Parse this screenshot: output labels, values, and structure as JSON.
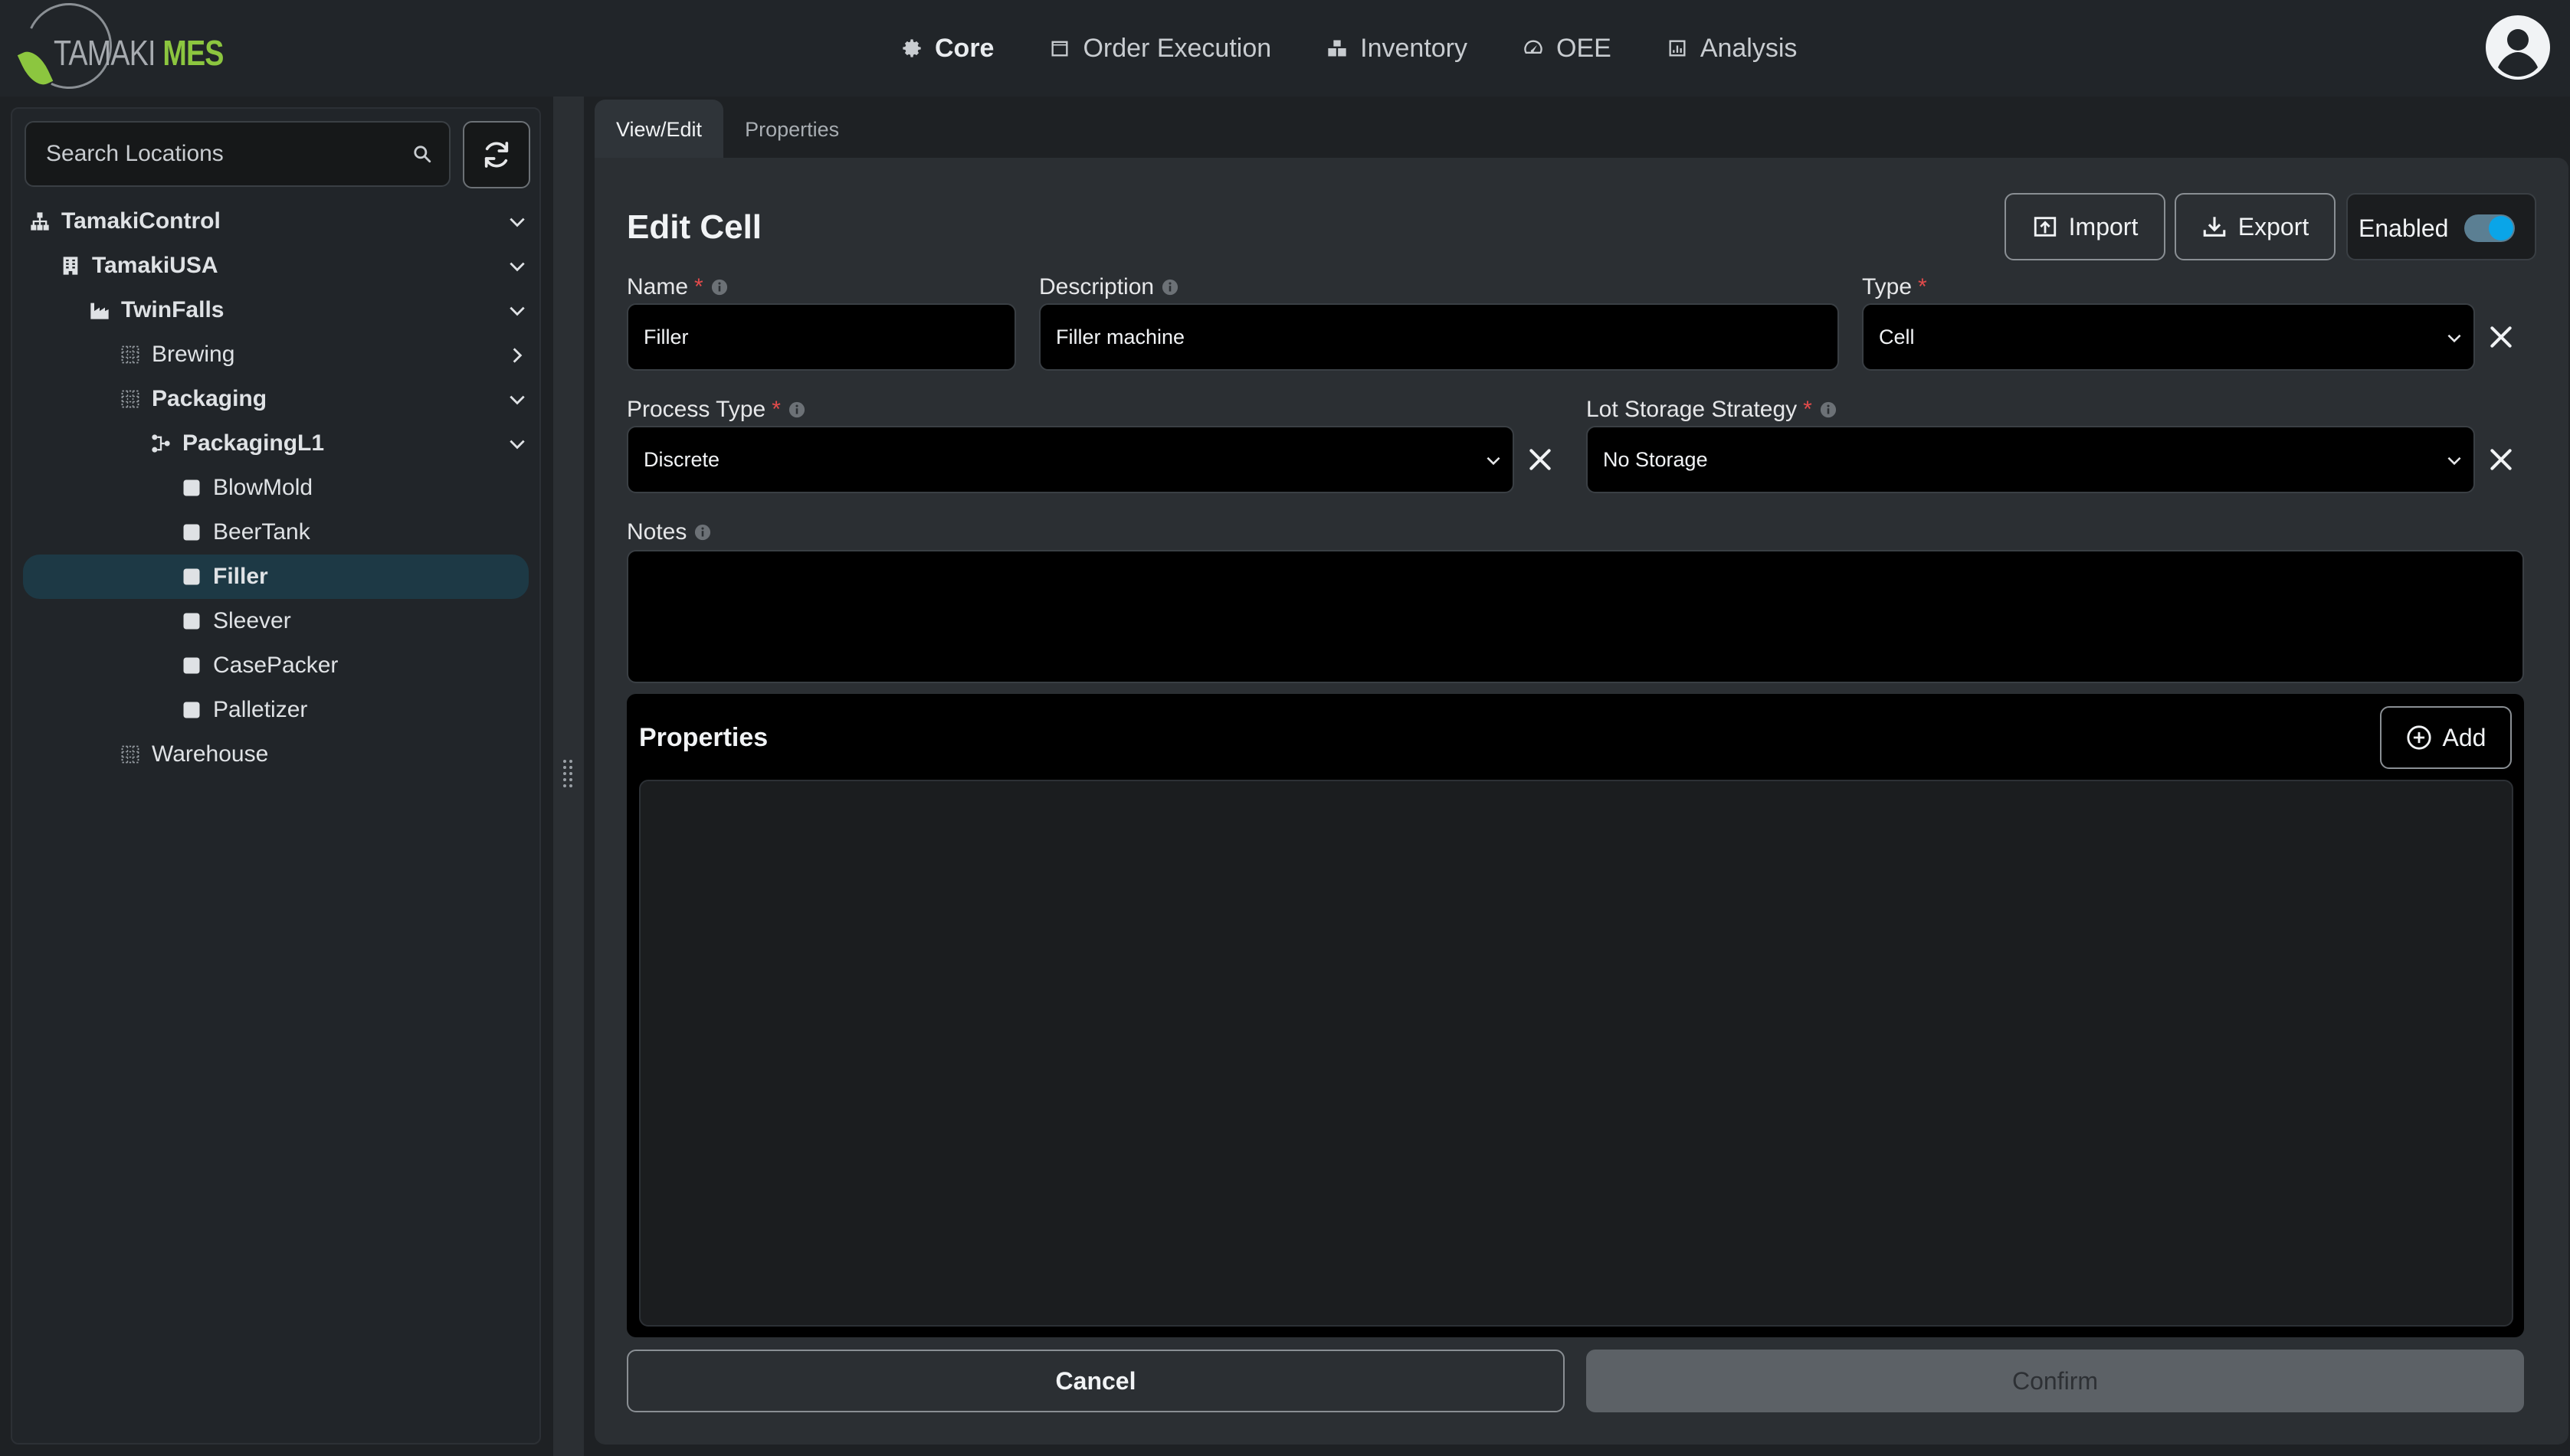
{
  "app": {
    "logo_part1": "TAMAKI",
    "logo_part2": "MES"
  },
  "nav": {
    "core": "Core",
    "order_execution": "Order Execution",
    "inventory": "Inventory",
    "oee": "OEE",
    "analysis": "Analysis",
    "active": "Core"
  },
  "sidebar": {
    "search_placeholder": "Search Locations",
    "tree": [
      {
        "label": "TamakiControl",
        "icon": "sitemap-icon",
        "expanded": true
      },
      {
        "label": "TamakiUSA",
        "icon": "building-icon",
        "expanded": true
      },
      {
        "label": "TwinFalls",
        "icon": "factory-icon",
        "expanded": true
      },
      {
        "label": "Brewing",
        "icon": "grid-icon",
        "expanded": false
      },
      {
        "label": "Packaging",
        "icon": "grid-icon",
        "expanded": true
      },
      {
        "label": "PackagingL1",
        "icon": "line-icon",
        "expanded": true
      },
      {
        "label": "BlowMold",
        "icon": "cell-icon"
      },
      {
        "label": "BeerTank",
        "icon": "cell-icon"
      },
      {
        "label": "Filler",
        "icon": "cell-icon",
        "selected": true
      },
      {
        "label": "Sleever",
        "icon": "cell-icon"
      },
      {
        "label": "CasePacker",
        "icon": "cell-icon"
      },
      {
        "label": "Palletizer",
        "icon": "cell-icon"
      },
      {
        "label": "Warehouse",
        "icon": "grid-icon"
      }
    ]
  },
  "tabs": {
    "view_edit": "View/Edit",
    "properties": "Properties",
    "active": "View/Edit"
  },
  "form": {
    "title": "Edit Cell",
    "import_label": "Import",
    "export_label": "Export",
    "enabled_label": "Enabled",
    "enabled": true,
    "name_label": "Name",
    "name_value": "Filler",
    "description_label": "Description",
    "description_value": "Filler machine",
    "type_label": "Type",
    "type_value": "Cell",
    "process_type_label": "Process Type",
    "process_type_value": "Discrete",
    "lot_storage_label": "Lot Storage Strategy",
    "lot_storage_value": "No Storage",
    "notes_label": "Notes",
    "notes_value": "",
    "required_mark": "*",
    "properties_title": "Properties",
    "add_label": "Add",
    "cancel_label": "Cancel",
    "confirm_label": "Confirm"
  },
  "colors": {
    "accent": "#0aa5e8",
    "brand_green": "#8cc63f",
    "required": "#e24b4b",
    "selected_row": "#1d3945"
  }
}
